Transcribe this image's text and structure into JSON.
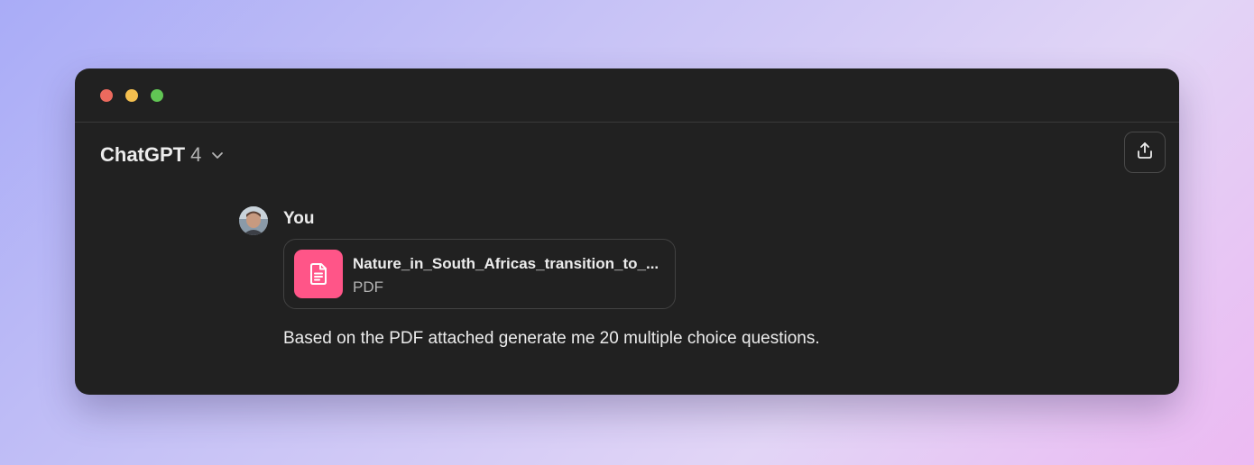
{
  "window": {
    "controls": [
      "close",
      "minimize",
      "maximize"
    ]
  },
  "header": {
    "model_name": "ChatGPT",
    "model_version": "4",
    "dropdown_icon": "chevron-down-icon",
    "share_icon": "share-upload-icon"
  },
  "message": {
    "sender": "You",
    "attachment": {
      "file_name": "Nature_in_South_Africas_transition_to_...",
      "file_type": "PDF",
      "icon": "document-icon",
      "icon_color": "#ff5588"
    },
    "text": "Based on the PDF attached generate me 20 multiple choice questions."
  },
  "colors": {
    "window_bg": "#212121",
    "text_primary": "#ececec",
    "text_secondary": "#b4b4b4",
    "close": "#ec6a5e",
    "minimize": "#f4bf4f",
    "maximize": "#61c554"
  }
}
